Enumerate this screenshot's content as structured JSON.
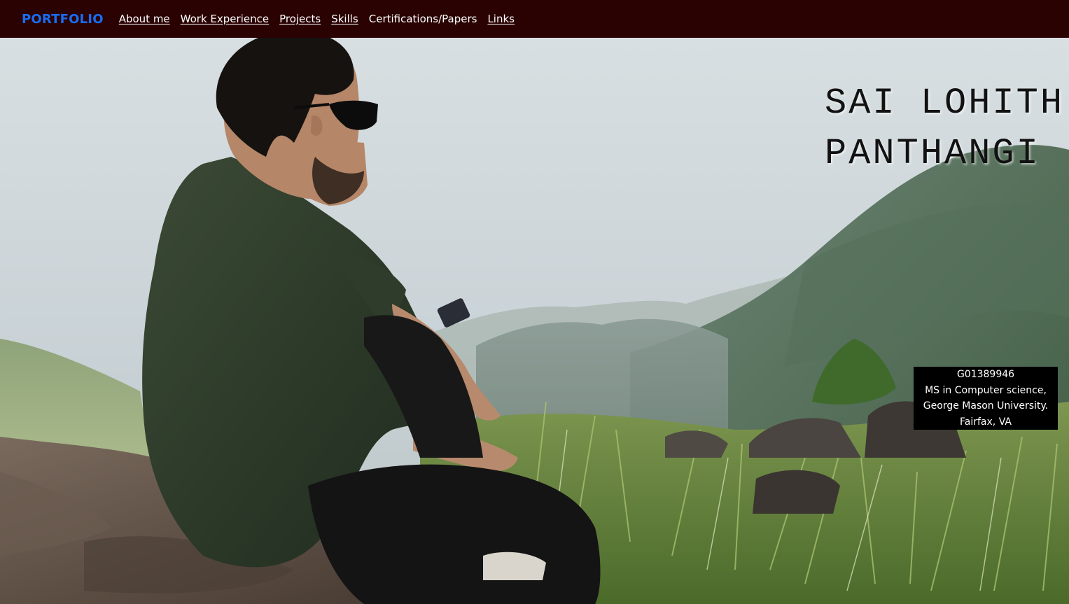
{
  "nav": {
    "brand": "PORTFOLIO",
    "links": [
      {
        "label": "About me",
        "underlined": true
      },
      {
        "label": "Work Experience",
        "underlined": true
      },
      {
        "label": "Projects",
        "underlined": true
      },
      {
        "label": "Skills",
        "underlined": true
      },
      {
        "label": "Certifications/Papers",
        "underlined": false
      },
      {
        "label": "Links",
        "underlined": true
      }
    ]
  },
  "hero": {
    "name_line1": "SAI LOHITH",
    "name_line2": "PANTHANGI",
    "info": {
      "id": "G01389946",
      "degree": "MS in Computer science,",
      "university": "George Mason University.",
      "location": "Fairfax, VA"
    },
    "photo_description_icon": "landscape-photo"
  },
  "colors": {
    "nav_bg": "#2a0202",
    "brand": "#1a6cf2",
    "nav_text": "#ffffff",
    "info_bg": "#000000",
    "name_text": "#121212"
  }
}
